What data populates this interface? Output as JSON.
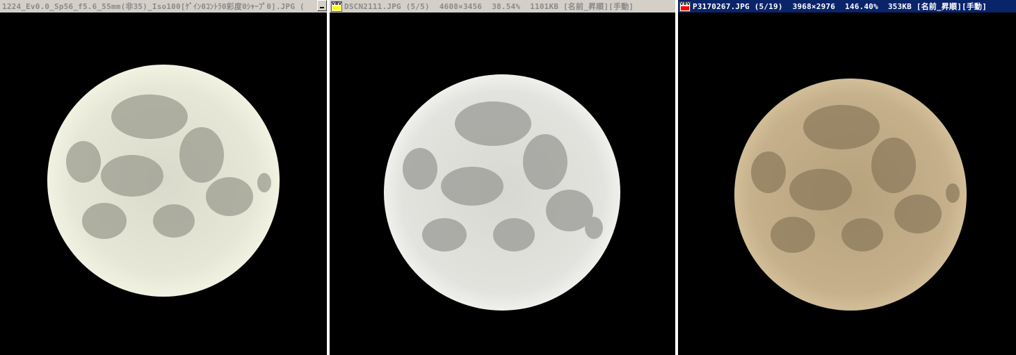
{
  "windows": [
    {
      "title": "1224_Ev0.0_Sp56_f5.6_55mm(非35)_Iso100[ｹﾞｲﾝ0ｺﾝﾄﾗ0彩度0ｼｬｰﾌﾟ0].JPG (",
      "state": "inactive",
      "moon_color": "#e9ead8"
    },
    {
      "filename": "DSCN2111.JPG",
      "index": "(5/5)",
      "dimensions": "4608×3456",
      "zoom": "38.54%",
      "filesize": "1101KB",
      "sort": "[名前_昇順][手動]",
      "state": "inactive",
      "icon_color": "#ffff00",
      "moon_color": "#e6e7e2"
    },
    {
      "filename": "P3170267.JPG",
      "index": "(5/19)",
      "dimensions": "3968×2976",
      "zoom": "146.40%",
      "filesize": "353KB",
      "sort": "[名前_昇順][手動]",
      "state": "active",
      "icon_color": "#ff0000",
      "moon_color": "#c4b08a"
    }
  ],
  "icon_label": "VBV"
}
